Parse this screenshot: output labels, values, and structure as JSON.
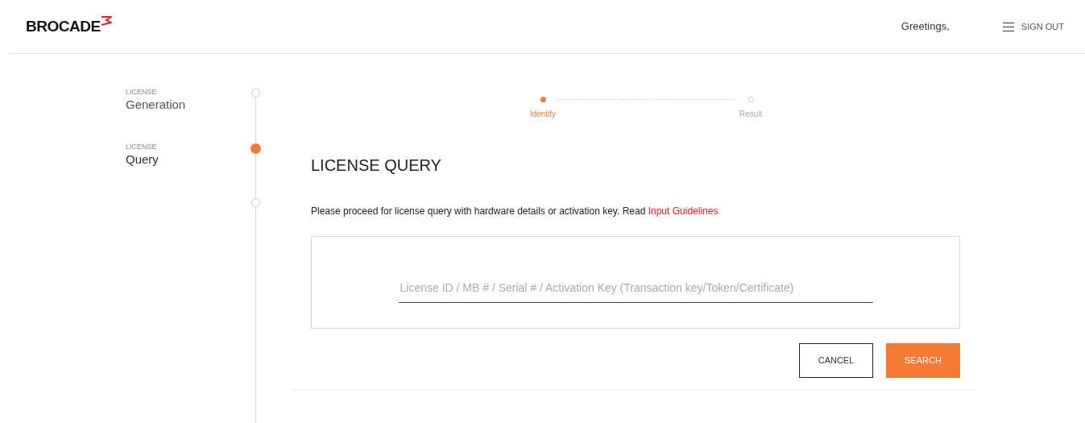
{
  "header": {
    "logo": "BROCADE",
    "greeting": "Greetings,",
    "sign_out": "SIGN OUT"
  },
  "sidebar": {
    "items": [
      {
        "caption": "LICENSE",
        "label": "Generation",
        "selected": false
      },
      {
        "caption": "LICENSE",
        "label": "Query",
        "selected": true
      }
    ]
  },
  "stepper": [
    {
      "label": "Identify",
      "selected": true
    },
    {
      "label": "Result",
      "selected": false
    }
  ],
  "title": "LICENSE QUERY",
  "intro": "Please proceed for license query with hardware details or activation key. Read",
  "intro_link": "Input Guidelines",
  "search": {
    "placeholder": "License ID / MB # / Serial # / Activation Key (Transaction key/Token/Certificate)"
  },
  "buttons": [
    {
      "label": "CANCEL",
      "kind": "outline"
    },
    {
      "label": "SEARCH",
      "kind": "primary"
    }
  ]
}
